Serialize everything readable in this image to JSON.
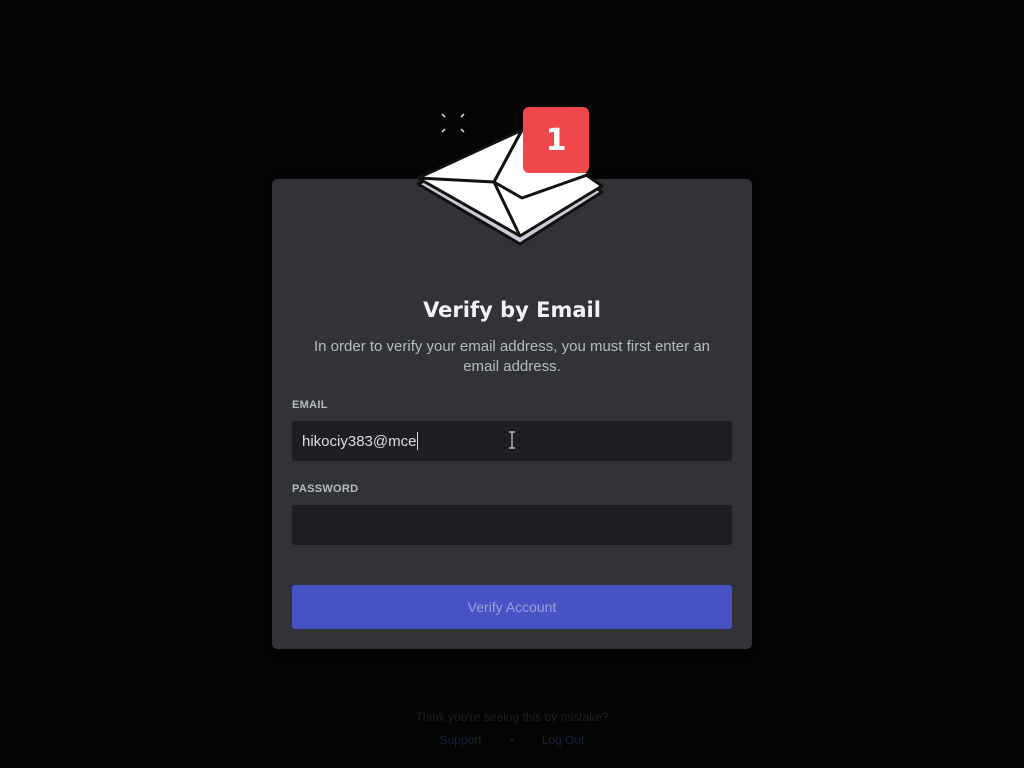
{
  "badge": {
    "count": "1",
    "color": "#f0484a"
  },
  "title": "Verify by Email",
  "subtitle": "In order to verify your email address, you must first enter an email address.",
  "form": {
    "email_label": "EMAIL",
    "email_value": "hikociy383@mce",
    "password_label": "PASSWORD",
    "password_value": "",
    "submit_label": "Verify Account"
  },
  "footer": {
    "text": "Think you're seeing this by mistake?",
    "support_link": "Support",
    "logout_link": "Log Out"
  },
  "colors": {
    "background": "#040404",
    "card": "#313338",
    "input": "#1e1f22",
    "button": "#4752c4"
  },
  "icons": [
    "envelope-icon",
    "sparkle-icon",
    "text-cursor-icon"
  ]
}
